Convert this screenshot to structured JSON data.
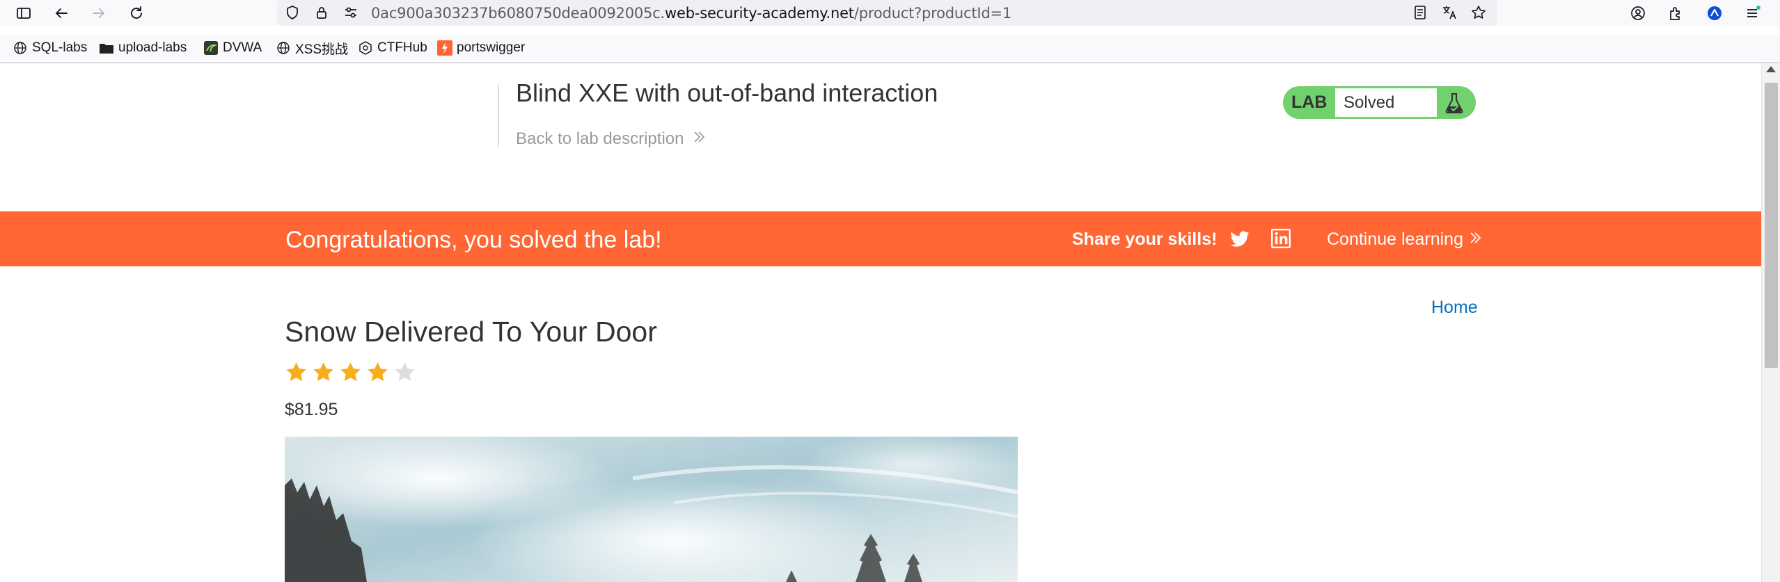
{
  "browser": {
    "url_prefix": "0ac900a303237b6080750dea0092005c.",
    "url_host": "web-security-academy.net",
    "url_path": "/product?productId=1",
    "bookmarks": [
      {
        "label": "SQL-labs",
        "icon": "globe-icon"
      },
      {
        "label": "upload-labs",
        "icon": "folder-icon"
      },
      {
        "label": "DVWA",
        "icon": "dvwa-icon"
      },
      {
        "label": "XSS挑战",
        "icon": "globe-icon"
      },
      {
        "label": "CTFHub",
        "icon": "ctfhub-icon"
      },
      {
        "label": "portswigger",
        "icon": "portswigger-icon"
      }
    ]
  },
  "header": {
    "lab_title": "Blind XXE with out-of-band interaction",
    "back_link": "Back to lab description",
    "badge_label": "LAB",
    "badge_status": "Solved",
    "badge_color": "#70d16d"
  },
  "banner": {
    "message": "Congratulations, you solved the lab!",
    "share_label": "Share your skills!",
    "continue_label": "Continue learning",
    "color": "#ff6633"
  },
  "nav": {
    "home": "Home"
  },
  "product": {
    "title": "Snow Delivered To Your Door",
    "rating": 4,
    "rating_max": 5,
    "price": "$81.95"
  }
}
